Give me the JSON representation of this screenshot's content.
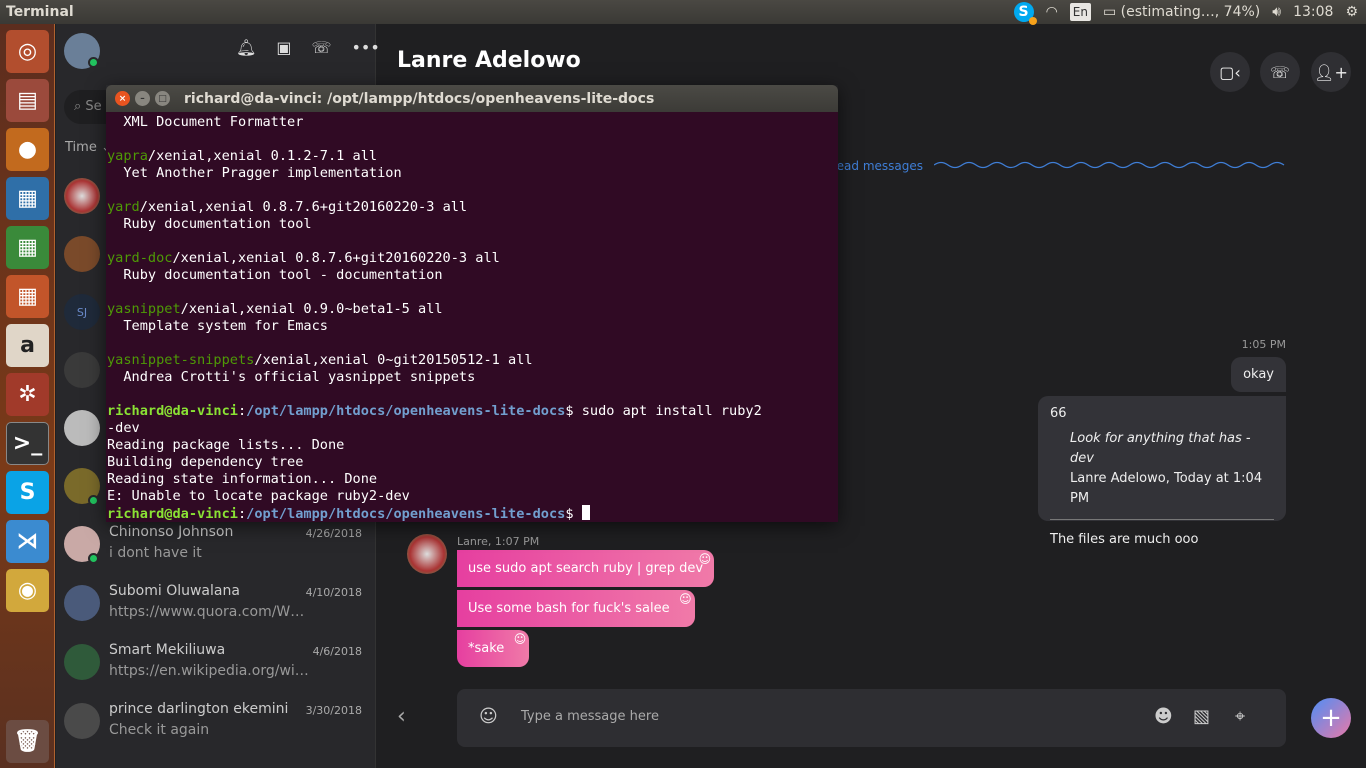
{
  "topbar": {
    "app": "Terminal",
    "lang": "En",
    "battery": "(estimating…, 74%)",
    "clock": "13:08"
  },
  "sidebar": {
    "search_placeholder": "Se",
    "sort_label": "Time ⌄",
    "chats": [
      {
        "name": "Chinonso Johnson",
        "preview": "i dont have it",
        "date": "4/26/2018",
        "online": true
      },
      {
        "name": "Subomi Oluwalana",
        "preview": "https://www.quora.com/Wh...",
        "date": "4/10/2018",
        "online": false
      },
      {
        "name": "Smart Mekiliuwa",
        "preview": "https://en.wikipedia.org/wiki/...",
        "date": "4/6/2018",
        "online": false
      },
      {
        "name": "prince darlington ekemini",
        "preview": "Check it again",
        "date": "3/30/2018",
        "online": false
      }
    ]
  },
  "chat": {
    "title": "Lanre Adelowo",
    "unread": "read messages",
    "time1": "1:05 PM",
    "okay": "okay",
    "quote": {
      "icon": "66",
      "text": "Look for anything that has -dev",
      "author": "Lanre Adelowo, Today at 1:04 PM",
      "reply": "The files are much ooo"
    },
    "sender": "Lanre, 1:07 PM",
    "messages": [
      "use sudo apt search ruby | grep dev",
      "Use some bash for fuck's salee",
      "*sake"
    ],
    "composer_placeholder": "Type a message here"
  },
  "terminal": {
    "title": "richard@da-vinci: /opt/lampp/htdocs/openheavens-lite-docs",
    "lines": [
      {
        "d": "  XML Document Formatter"
      },
      {
        "d": ""
      },
      {
        "p": "yapra",
        "d": "/xenial,xenial 0.1.2-7.1 all"
      },
      {
        "d": "  Yet Another Pragger implementation"
      },
      {
        "d": ""
      },
      {
        "p": "yard",
        "d": "/xenial,xenial 0.8.7.6+git20160220-3 all"
      },
      {
        "d": "  Ruby documentation tool"
      },
      {
        "d": ""
      },
      {
        "p": "yard-doc",
        "d": "/xenial,xenial 0.8.7.6+git20160220-3 all"
      },
      {
        "d": "  Ruby documentation tool - documentation"
      },
      {
        "d": ""
      },
      {
        "p": "yasnippet",
        "d": "/xenial,xenial 0.9.0~beta1-5 all"
      },
      {
        "d": "  Template system for Emacs"
      },
      {
        "d": ""
      },
      {
        "p": "yasnippet-snippets",
        "d": "/xenial,xenial 0~git20150512-1 all"
      },
      {
        "d": "  Andrea Crotti's official yasnippet snippets"
      },
      {
        "d": ""
      }
    ],
    "user": "richard@da-vinci",
    "path": "/opt/lampp/htdocs/openheavens-lite-docs",
    "command": "sudo apt install ruby2\n-dev",
    "output": "Reading package lists... Done\nBuilding dependency tree\nReading state information... Done\nE: Unable to locate package ruby2-dev"
  }
}
